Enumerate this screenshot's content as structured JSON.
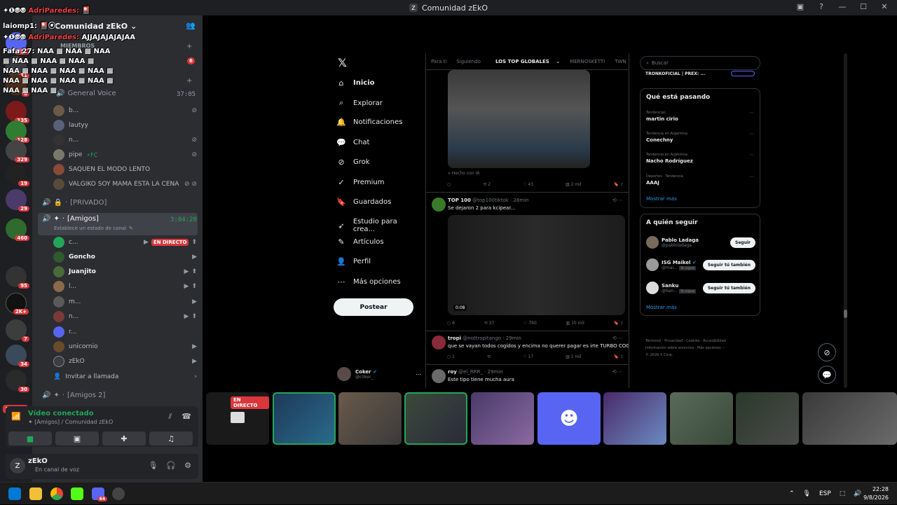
{
  "window": {
    "title": "Comunidad zEkO"
  },
  "overlay": {
    "line1_name": "AdriParedes:",
    "line2_prefix": "laiomp1:",
    "line3_name": "AdriParedes:",
    "line3_text": "AJJAJAJAJAJAA",
    "line4_prefix": "Fafa 27:",
    "naa": "NAA"
  },
  "server_badges": [
    "512",
    "11",
    "6",
    "135",
    "128",
    "329",
    "19",
    "29",
    "460",
    "95",
    "2K+",
    "7",
    "34",
    "30"
  ],
  "nuevo_badge": "NUEVO",
  "server": {
    "name": "Comunidad zEkO",
    "members_header": "MIEMBROS"
  },
  "channels": {
    "general_voice": "General Voice",
    "general_voice_time": "37:05",
    "general_users": [
      "b...",
      "lautyy",
      "n...",
      "pipe",
      "SAQUEN EL MODO LENTO",
      "VALGIKO SOY MAMA ESTA LA CENA"
    ],
    "pipe_tag": "FC",
    "privado": "[PRIVADO]",
    "amigos": "[Amigos]",
    "amigos_time": "3:04:20",
    "amigos_status": "Establece un estado de canal",
    "amigos_users": [
      "c...",
      "Goncho",
      "Juanjito",
      "l...",
      "m...",
      "n...",
      "r...",
      "unicornio",
      "zEkO"
    ],
    "live_label": "EN DIRECTO",
    "invite": "Invitar a llamada",
    "amigos2": "[Amigos 2]"
  },
  "voice": {
    "status": "Vídeo conectado",
    "location": "[Amigos] / Comunidad zEkO"
  },
  "user": {
    "name": "zEkO",
    "status": "En canal de voz"
  },
  "x": {
    "nav": [
      "Inicio",
      "Explorar",
      "Notificaciones",
      "Chat",
      "Grok",
      "Premium",
      "Guardados",
      "Estudio para crea...",
      "Artículos",
      "Perfil",
      "Más opciones"
    ],
    "post_button": "Postear",
    "account_name": "Coker",
    "account_handle": "@c0ker_",
    "tabs": [
      "Para ti",
      "Siguiendo",
      "LOS TOP GLOBALES",
      "MERNOSKETTI",
      "TWN"
    ],
    "ai_label": "Hecho con IA",
    "t1_actions": [
      "",
      "2",
      "43",
      "2 mil"
    ],
    "t2_name": "TOP 100",
    "t2_meta": "@top100tiktok · 28min",
    "t2_text": "Se dejaron 2 para kcipear...",
    "t2_video_time": "0:08",
    "t2_actions": [
      "6",
      "37",
      "760",
      "10 mil"
    ],
    "t3_name": "tropi",
    "t3_meta": "@nottropitango · 29min",
    "t3_text": "que se vayan todos cogidos y encima no querer pagar es irte TURBO COGIDO.",
    "t3_actions": [
      "1",
      "",
      "17",
      "1 mil"
    ],
    "t4_name": "roy",
    "t4_meta": "@el_RRR_ · 29min",
    "t4_text": "Este tipo tiene mucha aura",
    "search_placeholder": "Buscar",
    "top_card_name": "TRONKOFICIAL | PREX: ...",
    "trending_title": "Qué está pasando",
    "trends": [
      {
        "cat": "Tendencias",
        "name": "martin cirio"
      },
      {
        "cat": "Tendencia en Argentina",
        "name": "Conechny"
      },
      {
        "cat": "Tendencia en Argentina",
        "name": "Nacho Rodríguez"
      },
      {
        "cat": "Deportes · Tendencia",
        "name": "AAAJ"
      }
    ],
    "show_more": "Mostrar más",
    "follow_title": "A quién seguir",
    "follow": [
      {
        "name": "Pablo Ladaga",
        "handle": "@pabloladaga",
        "btn": "Seguir",
        "tag": ""
      },
      {
        "name": "ISG Maikel",
        "handle": "@mai...",
        "btn": "Seguir tú también",
        "tag": "Te sigue"
      },
      {
        "name": "Sanku",
        "handle": "@San...",
        "btn": "Seguir tú también",
        "tag": "Te sigue"
      }
    ],
    "show_more2": "Mostrar más",
    "footer1": "Términos · Privacidad · Cookies · Accesibilidad ·",
    "footer2": "Información sobre anuncios · Más opciones ···",
    "footer3": "© 2026 X Corp."
  },
  "stream_tile_live": "EN DIRECTO",
  "taskbar": {
    "lang": "ESP",
    "time": "22:28",
    "date": "9/8/2026",
    "discord_badge": "64"
  }
}
